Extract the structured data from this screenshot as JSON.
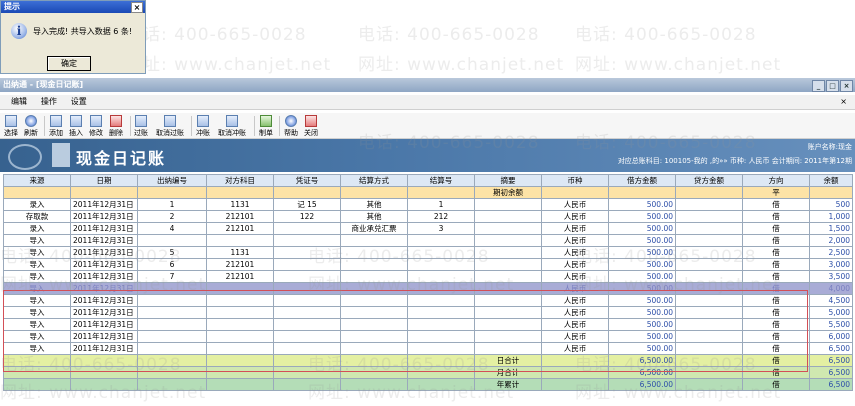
{
  "dialog": {
    "title": "提示",
    "close": "×",
    "icon": "info-icon",
    "message": "导入完成! 共导入数据 6 条!",
    "ok_label": "确定"
  },
  "watermark": {
    "phone": "电话: 400-665-0028",
    "web": "网址: www.chanjet.net"
  },
  "window": {
    "title": "出纳通 - [现金日记账]",
    "buttons": [
      "_",
      "□",
      "×"
    ]
  },
  "menu": {
    "items": [
      "编辑",
      "操作",
      "设置"
    ],
    "close": "×"
  },
  "toolbar": [
    {
      "label": "选择",
      "icon": "select-icon"
    },
    {
      "label": "刷新",
      "icon": "refresh-icon"
    },
    {
      "label": "添加",
      "icon": "add-icon"
    },
    {
      "label": "插入",
      "icon": "insert-icon"
    },
    {
      "label": "修改",
      "icon": "edit-icon"
    },
    {
      "label": "删除",
      "icon": "delete-icon"
    },
    {
      "label": "过账",
      "icon": "post-icon"
    },
    {
      "label": "取消过账",
      "icon": "unpost-icon"
    },
    {
      "label": "冲账",
      "icon": "reverse-icon"
    },
    {
      "label": "取消冲账",
      "icon": "cancel-reverse-icon"
    },
    {
      "label": "制单",
      "icon": "voucher-icon"
    },
    {
      "label": "帮助",
      "icon": "help-icon"
    },
    {
      "label": "关闭",
      "icon": "close-icon"
    }
  ],
  "banner": {
    "title": "现金日记账",
    "account": "账户名称:现金",
    "info": "对应总账科目: 100105-我的 ,的»»   币种: 人民币   会计期间: 2011年第12期"
  },
  "table": {
    "columns": [
      "来源",
      "日期",
      "出纳编号",
      "对方科目",
      "凭证号",
      "结算方式",
      "结算号",
      "摘要",
      "币种",
      "借方金额",
      "贷方金额",
      "方向",
      "余额"
    ],
    "opening": {
      "summary": "期初余额",
      "direction": "平"
    },
    "rows": [
      [
        "录入",
        "2011年12月31日",
        "1",
        "1131",
        "记  15",
        "其他",
        "1",
        "",
        "人民币",
        "500.00",
        "",
        "借",
        "500"
      ],
      [
        "存取款",
        "2011年12月31日",
        "2",
        "212101",
        "122",
        "其他",
        "212",
        "",
        "人民币",
        "500.00",
        "",
        "借",
        "1,000"
      ],
      [
        "录入",
        "2011年12月31日",
        "4",
        "212101",
        "",
        "商业承兑汇票",
        "3",
        "",
        "人民币",
        "500.00",
        "",
        "借",
        "1,500"
      ],
      [
        "导入",
        "2011年12月31日",
        "",
        "",
        "",
        "",
        "",
        "",
        "人民币",
        "500.00",
        "",
        "借",
        "2,000"
      ],
      [
        "导入",
        "2011年12月31日",
        "5",
        "1131",
        "",
        "",
        "",
        "",
        "人民币",
        "500.00",
        "",
        "借",
        "2,500"
      ],
      [
        "导入",
        "2011年12月31日",
        "6",
        "212101",
        "",
        "",
        "",
        "",
        "人民币",
        "500.00",
        "",
        "借",
        "3,000"
      ],
      [
        "导入",
        "2011年12月31日",
        "7",
        "212101",
        "",
        "",
        "",
        "",
        "人民币",
        "500.00",
        "",
        "借",
        "3,500"
      ],
      [
        "导入",
        "2011年12月31日",
        "",
        "",
        "",
        "",
        "",
        "",
        "人民币",
        "500.00",
        "",
        "借",
        "4,000"
      ],
      [
        "导入",
        "2011年12月31日",
        "",
        "",
        "",
        "",
        "",
        "",
        "人民币",
        "500.00",
        "",
        "借",
        "4,500"
      ],
      [
        "导入",
        "2011年12月31日",
        "",
        "",
        "",
        "",
        "",
        "",
        "人民币",
        "500.00",
        "",
        "借",
        "5,000"
      ],
      [
        "导入",
        "2011年12月31日",
        "",
        "",
        "",
        "",
        "",
        "",
        "人民币",
        "500.00",
        "",
        "借",
        "5,500"
      ],
      [
        "导入",
        "2011年12月31日",
        "",
        "",
        "",
        "",
        "",
        "",
        "人民币",
        "500.00",
        "",
        "借",
        "6,000"
      ],
      [
        "导入",
        "2011年12月31日",
        "",
        "",
        "",
        "",
        "",
        "",
        "人民币",
        "500.00",
        "",
        "借",
        "6,500"
      ]
    ],
    "selected_row": 7,
    "totals": [
      {
        "summary": "日合计",
        "debit": "6,500.00",
        "direction": "借",
        "balance": "6,500"
      },
      {
        "summary": "月合计",
        "debit": "6,500.00",
        "direction": "借",
        "balance": "6,500"
      },
      {
        "summary": "年累计",
        "debit": "6,500.00",
        "direction": "借",
        "balance": "6,500"
      }
    ]
  }
}
